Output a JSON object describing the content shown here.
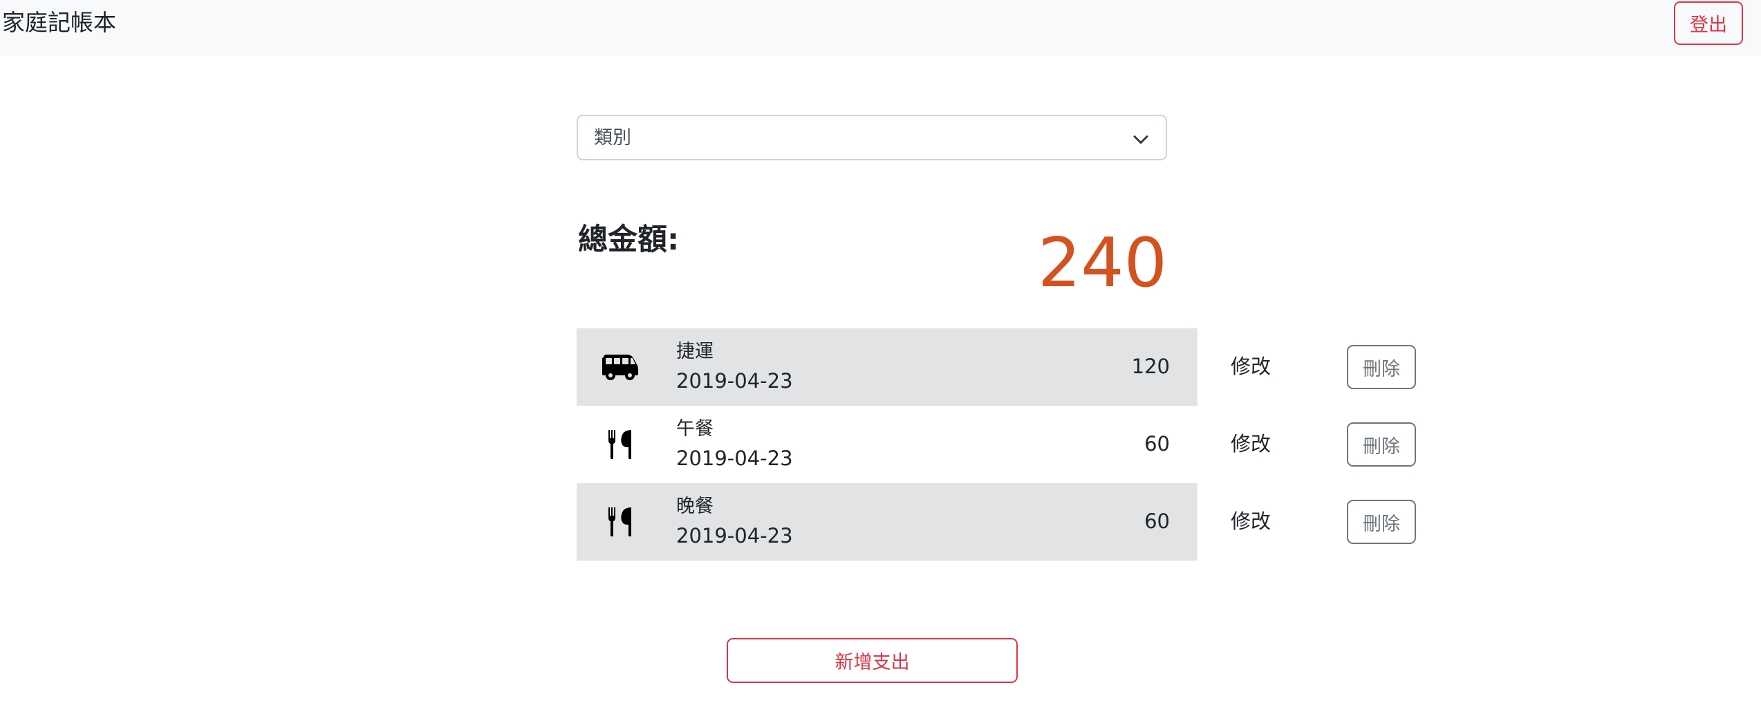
{
  "navbar": {
    "brand": "家庭記帳本",
    "logout_label": "登出"
  },
  "filter": {
    "category_label": "類別",
    "icon": "chevron-down-icon"
  },
  "summary": {
    "total_label": "總金額:",
    "total_amount": "240",
    "total_color": "#d4521e"
  },
  "records": [
    {
      "icon": "bus-icon",
      "name": "捷運",
      "date": "2019-04-23",
      "amount": "120",
      "edit_label": "修改",
      "delete_label": "刪除"
    },
    {
      "icon": "utensils-icon",
      "name": "午餐",
      "date": "2019-04-23",
      "amount": "60",
      "edit_label": "修改",
      "delete_label": "刪除"
    },
    {
      "icon": "utensils-icon",
      "name": "晚餐",
      "date": "2019-04-23",
      "amount": "60",
      "edit_label": "修改",
      "delete_label": "刪除"
    }
  ],
  "actions": {
    "add_label": "新增支出"
  },
  "colors": {
    "danger": "#dc3545",
    "secondary": "#6c757d",
    "row_stripe": "#e2e3e5",
    "navbar_bg": "#f8f9fa"
  }
}
